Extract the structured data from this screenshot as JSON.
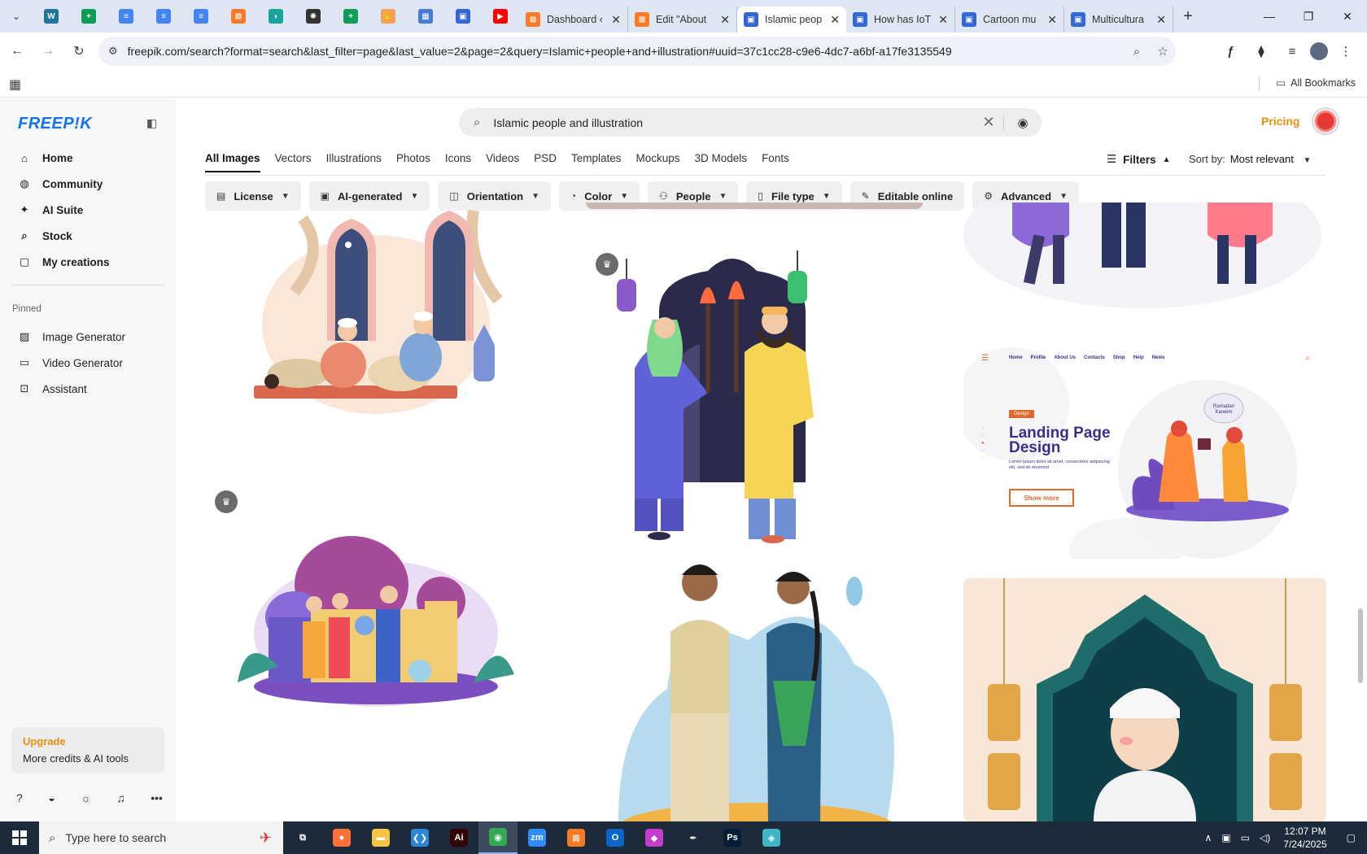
{
  "browser": {
    "pinned_tabs": [
      {
        "icon": "wordpress-icon",
        "color": "#21759b",
        "glyph": "W"
      },
      {
        "icon": "sheets-icon",
        "color": "#0f9d58",
        "glyph": "+"
      },
      {
        "icon": "docs-icon",
        "color": "#4285f4",
        "glyph": "≡"
      },
      {
        "icon": "docs-icon",
        "color": "#4285f4",
        "glyph": "≡"
      },
      {
        "icon": "docs-icon",
        "color": "#4285f4",
        "glyph": "≡"
      },
      {
        "icon": "xampp-icon",
        "color": "#fb7a24",
        "glyph": "⊠"
      },
      {
        "icon": "app-icon",
        "color": "#1ba39c",
        "glyph": "◗"
      },
      {
        "icon": "openai-icon",
        "color": "#333333",
        "glyph": "✺"
      },
      {
        "icon": "sheets-icon",
        "color": "#0f9d58",
        "glyph": "+"
      },
      {
        "icon": "hand-icon",
        "color": "#f3a25a",
        "glyph": "✋"
      },
      {
        "icon": "grid-doc-icon",
        "color": "#4a7bd4",
        "glyph": "▦"
      },
      {
        "icon": "forms-icon",
        "color": "#3367d6",
        "glyph": "▣"
      },
      {
        "icon": "youtube-icon",
        "color": "#ff0000",
        "glyph": "▶"
      }
    ],
    "tabs": [
      {
        "title": "Dashboard ‹",
        "icon": "xampp-icon",
        "color": "#fb7a24",
        "glyph": "⊠",
        "active": false
      },
      {
        "title": "Edit \"About",
        "icon": "xampp-icon",
        "color": "#fb7a24",
        "glyph": "⊠",
        "active": false
      },
      {
        "title": "Islamic peop",
        "icon": "forms-icon",
        "color": "#3367d6",
        "glyph": "▣",
        "active": true
      },
      {
        "title": "How has IoT",
        "icon": "forms-icon",
        "color": "#3367d6",
        "glyph": "▣",
        "active": false
      },
      {
        "title": "Cartoon mu",
        "icon": "forms-icon",
        "color": "#3367d6",
        "glyph": "▣",
        "active": false
      },
      {
        "title": "Multicultura",
        "icon": "forms-icon",
        "color": "#3367d6",
        "glyph": "▣",
        "active": false
      }
    ],
    "tab_close": "✕",
    "new_tab": "+",
    "url": "freepik.com/search?format=search&last_filter=page&last_value=2&page=2&query=Islamic+people+and+illustration#uuid=37c1cc28-c9e6-4dc7-a6bf-a17fe3135549",
    "bookmarks_label": "All Bookmarks"
  },
  "sidebar": {
    "logo": "FREEP!K",
    "nav": [
      {
        "label": "Home",
        "icon": "home-icon",
        "glyph": "⌂"
      },
      {
        "label": "Community",
        "icon": "globe-icon",
        "glyph": "◍"
      },
      {
        "label": "AI Suite",
        "icon": "sparkle-icon",
        "glyph": "✦"
      },
      {
        "label": "Stock",
        "icon": "search-icon",
        "glyph": "⌕"
      },
      {
        "label": "My creations",
        "icon": "folder-icon",
        "glyph": "▢"
      }
    ],
    "pinned_label": "Pinned",
    "pinned": [
      {
        "label": "Image Generator",
        "icon": "image-icon",
        "glyph": "▨"
      },
      {
        "label": "Video Generator",
        "icon": "video-icon",
        "glyph": "▭"
      },
      {
        "label": "Assistant",
        "icon": "assistant-icon",
        "glyph": "⊡"
      }
    ],
    "upgrade_title": "Upgrade",
    "upgrade_sub": "More credits & AI tools"
  },
  "header": {
    "search_value": "Islamic people and illustration",
    "pricing": "Pricing"
  },
  "type_tabs": [
    "All Images",
    "Vectors",
    "Illustrations",
    "Photos",
    "Icons",
    "Videos",
    "PSD",
    "Templates",
    "Mockups",
    "3D Models",
    "Fonts"
  ],
  "filters_label": "Filters",
  "sort_label": "Sort by:",
  "sort_value": "Most relevant",
  "chips": [
    {
      "label": "License",
      "icon": "license-icon",
      "glyph": "▤"
    },
    {
      "label": "AI-generated",
      "icon": "ai-icon",
      "glyph": "▣"
    },
    {
      "label": "Orientation",
      "icon": "orientation-icon",
      "glyph": "◫"
    },
    {
      "label": "Color",
      "icon": "color-icon",
      "glyph": "◔"
    },
    {
      "label": "People",
      "icon": "people-icon",
      "glyph": "⚇"
    },
    {
      "label": "File type",
      "icon": "file-icon",
      "glyph": "▯"
    },
    {
      "label": "Editable online",
      "icon": "pen-icon",
      "glyph": "✎"
    },
    {
      "label": "Advanced",
      "icon": "settings-icon",
      "glyph": "⚙"
    }
  ],
  "landing": {
    "nav": [
      "Home",
      "Profile",
      "About Us",
      "Contacts",
      "Shop",
      "Help",
      "News"
    ],
    "tag": "Design",
    "title_line1": "Landing Page",
    "title_line2": "Design",
    "body": "Lorem ipsum dolor sit amet, consectetur adipiscing elit, sed do eiusmod",
    "button": "Show more",
    "bubble": "Ramadan Kareem"
  },
  "taskbar": {
    "search_placeholder": "Type here to search",
    "time": "12:07 PM",
    "date": "7/24/2025",
    "apps": [
      {
        "icon": "task-view-icon",
        "color": "#1c2a3a",
        "glyph": "⧉"
      },
      {
        "icon": "firefox-icon",
        "color": "#ff7139",
        "glyph": "●"
      },
      {
        "icon": "file-explorer-icon",
        "color": "#f6c343",
        "glyph": "▬"
      },
      {
        "icon": "vscode-icon",
        "color": "#2b88d8",
        "glyph": "❮❯"
      },
      {
        "icon": "illustrator-icon",
        "color": "#330000",
        "glyph": "Ai"
      },
      {
        "icon": "chrome-icon",
        "color": "#34a853",
        "glyph": "◉"
      },
      {
        "icon": "zoom-icon",
        "color": "#2d8cff",
        "glyph": "zm"
      },
      {
        "icon": "xampp-icon",
        "color": "#fb7a24",
        "glyph": "⊠"
      },
      {
        "icon": "outlook-icon",
        "color": "#0a64c9",
        "glyph": "O"
      },
      {
        "icon": "affinity-icon",
        "color": "#c53ccf",
        "glyph": "◆"
      },
      {
        "icon": "pen-tool-icon",
        "color": "#1c2a3a",
        "glyph": "✒"
      },
      {
        "icon": "photoshop-icon",
        "color": "#001e36",
        "glyph": "Ps"
      },
      {
        "icon": "app-icon",
        "color": "#3fb5c5",
        "glyph": "◈"
      }
    ]
  },
  "colors": {
    "accent": "#1273eb",
    "pricing": "#e8900c",
    "landing_accent": "#3f2d8a",
    "landing_button": "#e2682d"
  }
}
